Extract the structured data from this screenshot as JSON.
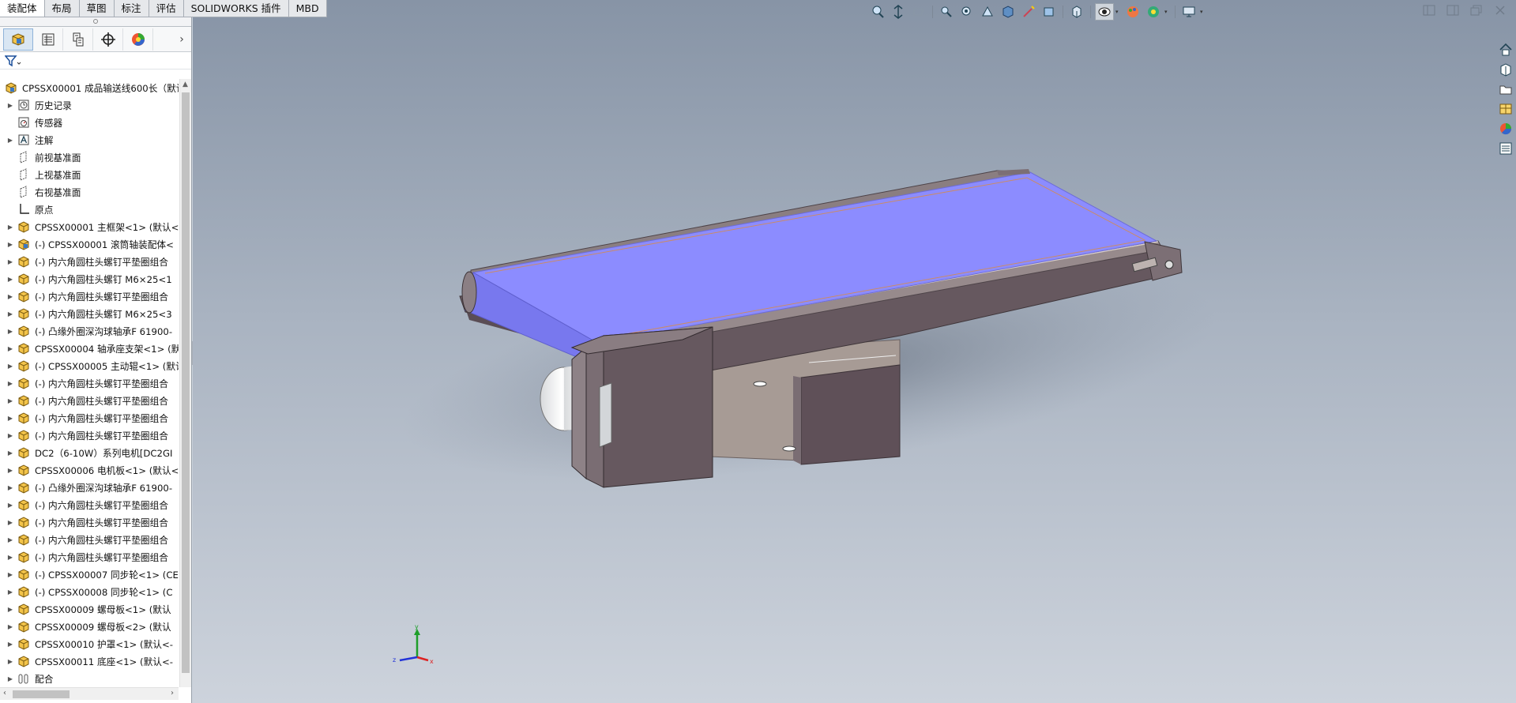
{
  "command_tabs": [
    "装配体",
    "布局",
    "草图",
    "标注",
    "评估",
    "SOLIDWORKS 插件",
    "MBD"
  ],
  "feature_tree": {
    "root": "CPSSX00001 成品输送线600长（默认",
    "items": [
      {
        "label": "历史记录",
        "icon": "history-icon",
        "arrow": true
      },
      {
        "label": "传感器",
        "icon": "sensor-icon",
        "arrow": false
      },
      {
        "label": "注解",
        "icon": "annotation-icon",
        "arrow": true
      },
      {
        "label": "前视基准面",
        "icon": "plane-icon",
        "arrow": false
      },
      {
        "label": "上视基准面",
        "icon": "plane-icon",
        "arrow": false
      },
      {
        "label": "右视基准面",
        "icon": "plane-icon",
        "arrow": false
      },
      {
        "label": "原点",
        "icon": "origin-icon",
        "arrow": false
      },
      {
        "label": "CPSSX00001 主框架<1> (默认<",
        "icon": "part-icon",
        "arrow": true
      },
      {
        "label": "(-) CPSSX00001 滚筒轴装配体<",
        "icon": "assembly-icon",
        "arrow": true
      },
      {
        "label": "(-) 内六角圆柱头螺钉平垫圈组合",
        "icon": "part-icon",
        "arrow": true
      },
      {
        "label": "(-) 内六角圆柱头螺钉 M6×25<1",
        "icon": "part-icon",
        "arrow": true
      },
      {
        "label": "(-) 内六角圆柱头螺钉平垫圈组合",
        "icon": "part-icon",
        "arrow": true
      },
      {
        "label": "(-) 内六角圆柱头螺钉 M6×25<3",
        "icon": "part-icon",
        "arrow": true
      },
      {
        "label": "(-) 凸缘外圈深沟球轴承F 61900-",
        "icon": "part-icon",
        "arrow": true
      },
      {
        "label": "CPSSX00004 轴承座支架<1> (默",
        "icon": "part-icon",
        "arrow": true
      },
      {
        "label": "(-) CPSSX00005 主动辊<1> (默认",
        "icon": "part-icon",
        "arrow": true
      },
      {
        "label": "(-) 内六角圆柱头螺钉平垫圈组合",
        "icon": "part-icon",
        "arrow": true
      },
      {
        "label": "(-) 内六角圆柱头螺钉平垫圈组合",
        "icon": "part-icon",
        "arrow": true
      },
      {
        "label": "(-) 内六角圆柱头螺钉平垫圈组合",
        "icon": "part-icon",
        "arrow": true
      },
      {
        "label": "(-) 内六角圆柱头螺钉平垫圈组合",
        "icon": "part-icon",
        "arrow": true
      },
      {
        "label": "DC2（6-10W）系列电机[DC2GI",
        "icon": "part-icon",
        "arrow": true
      },
      {
        "label": "CPSSX00006 电机板<1> (默认<",
        "icon": "part-icon",
        "arrow": true
      },
      {
        "label": "(-) 凸缘外圈深沟球轴承F 61900-",
        "icon": "part-icon",
        "arrow": true
      },
      {
        "label": "(-) 内六角圆柱头螺钉平垫圈组合",
        "icon": "part-icon",
        "arrow": true
      },
      {
        "label": "(-) 内六角圆柱头螺钉平垫圈组合",
        "icon": "part-icon",
        "arrow": true
      },
      {
        "label": "(-) 内六角圆柱头螺钉平垫圈组合",
        "icon": "part-icon",
        "arrow": true
      },
      {
        "label": "(-) 内六角圆柱头螺钉平垫圈组合",
        "icon": "part-icon",
        "arrow": true
      },
      {
        "label": "(-) CPSSX00007 同步轮<1> (CE",
        "icon": "part-icon",
        "arrow": true
      },
      {
        "label": "(-) CPSSX00008  同步轮<1> (C",
        "icon": "part-icon",
        "arrow": true
      },
      {
        "label": "CPSSX00009  螺母板<1> (默认",
        "icon": "part-icon",
        "arrow": true
      },
      {
        "label": "CPSSX00009  螺母板<2> (默认",
        "icon": "part-icon",
        "arrow": true
      },
      {
        "label": "CPSSX00010  护罩<1> (默认<-",
        "icon": "part-icon",
        "arrow": true
      },
      {
        "label": "CPSSX00011  底座<1> (默认<-",
        "icon": "part-icon",
        "arrow": true
      },
      {
        "label": "配合",
        "icon": "mates-icon",
        "arrow": true
      }
    ]
  },
  "triad": {
    "x": "x",
    "y": "y",
    "z": "z"
  },
  "colors": {
    "belt": "#8c8cff",
    "frame": "#66585f",
    "viewport_top": "#8794a6",
    "viewport_bottom": "#cdd3dc"
  }
}
